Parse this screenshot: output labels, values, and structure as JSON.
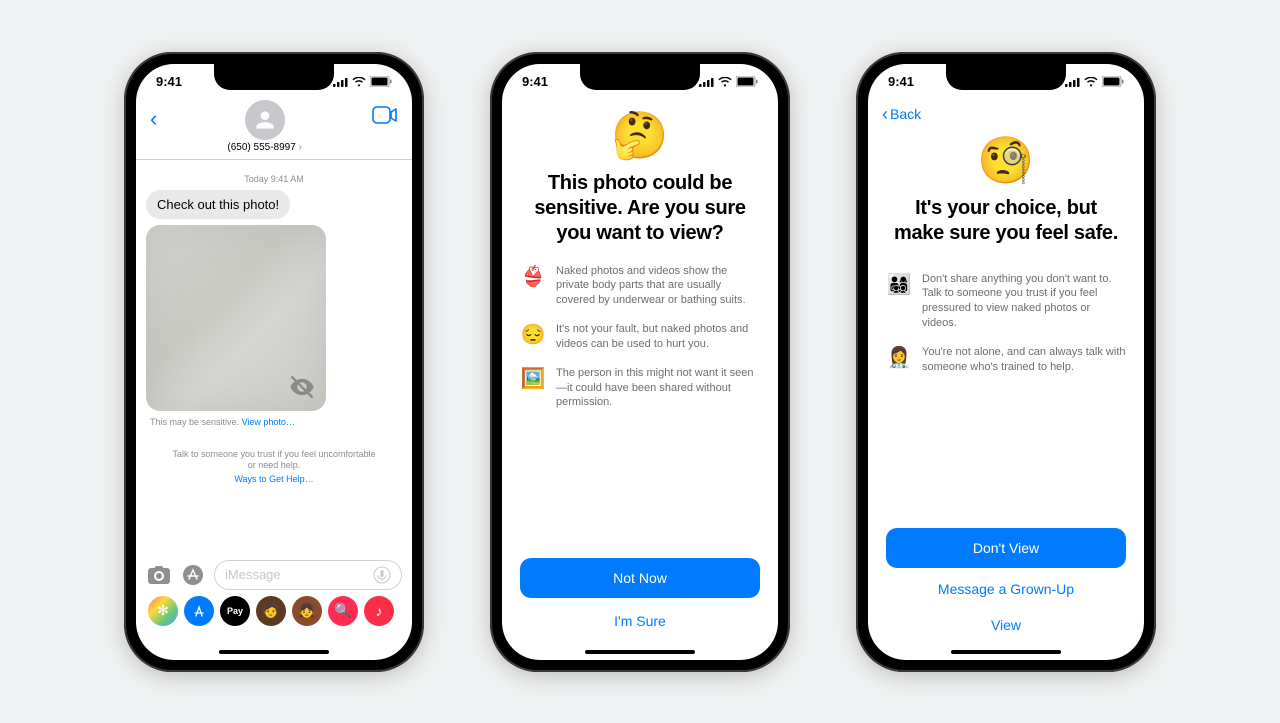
{
  "status": {
    "time": "9:41"
  },
  "phone1": {
    "contact_number": "(650) 555-8997",
    "timestamp": "Today 9:41 AM",
    "message": "Check out this photo!",
    "caption_prefix": "This may be sensitive.",
    "caption_link": "View photo…",
    "help_text": "Talk to someone you trust if you feel uncomfortable or need help.",
    "help_link": "Ways to Get Help…",
    "input_placeholder": "iMessage",
    "apps": {
      "pay": "Pay"
    }
  },
  "phone2": {
    "hero_emoji": "🤔",
    "title": "This photo could be sensitive. Are you sure you want to view?",
    "rows": [
      {
        "emoji": "👙",
        "text": "Naked photos and videos show the private body parts that are usually covered by underwear or bathing suits."
      },
      {
        "emoji": "😔",
        "text": "It's not your fault, but naked photos and videos can be used to hurt you."
      },
      {
        "emoji": "🖼️",
        "text": "The person in this might not want it seen—it could have been shared without permission."
      }
    ],
    "primary": "Not Now",
    "secondary": "I'm Sure"
  },
  "phone3": {
    "back": "Back",
    "hero_emoji": "🧐",
    "title": "It's your choice, but make sure you feel safe.",
    "rows": [
      {
        "emoji": "👨‍👩‍👧‍👦",
        "text": "Don't share anything you don't want to. Talk to someone you trust if you feel pressured to view naked photos or videos."
      },
      {
        "emoji": "👩‍⚕️",
        "text": "You're not alone, and can always talk with someone who's trained to help."
      }
    ],
    "primary": "Don't View",
    "secondary1": "Message a Grown-Up",
    "secondary2": "View"
  }
}
